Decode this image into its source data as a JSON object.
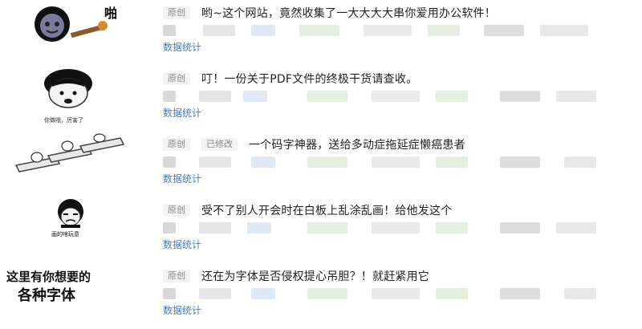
{
  "colors": {
    "link": "#3f7bd1",
    "tag_bg": "#f3f3f3",
    "tag_text": "#888888"
  },
  "articles": [
    {
      "thumb_icon": "panda-meme-with-bat",
      "thumb_text": "啪",
      "tags": [
        "原创"
      ],
      "title": "哟~这个网站，竟然收集了一大大大大串你爱用办公软件！",
      "stats_label": "数据统计"
    },
    {
      "thumb_icon": "bowl-cut-meme-face",
      "thumb_text": "你做哦，厉害了",
      "tags": [
        "原创"
      ],
      "title": "叮！一份关于PDF文件的终极干货请查收。",
      "stats_label": "数据统计"
    },
    {
      "thumb_icon": "typing-keyboards-meme",
      "tags": [
        "原创",
        "已修改"
      ],
      "title": "一个码字神器，送给多动症拖延症懒癌患者",
      "stats_label": "数据统计"
    },
    {
      "thumb_icon": "crying-face-meme",
      "thumb_text": "画的啥玩意",
      "tags": [
        "原创"
      ],
      "title": "受不了别人开会时在白板上乱涂乱画！给他发这个",
      "stats_label": "数据统计"
    },
    {
      "thumb_icon": "handwritten-text-meme",
      "thumb_lines": [
        "这里有你想要的",
        "各种字体"
      ],
      "tags": [
        "原创"
      ],
      "title": "还在为字体是否侵权提心吊胆？！就赶紧用它",
      "stats_label": "数据统计"
    }
  ]
}
